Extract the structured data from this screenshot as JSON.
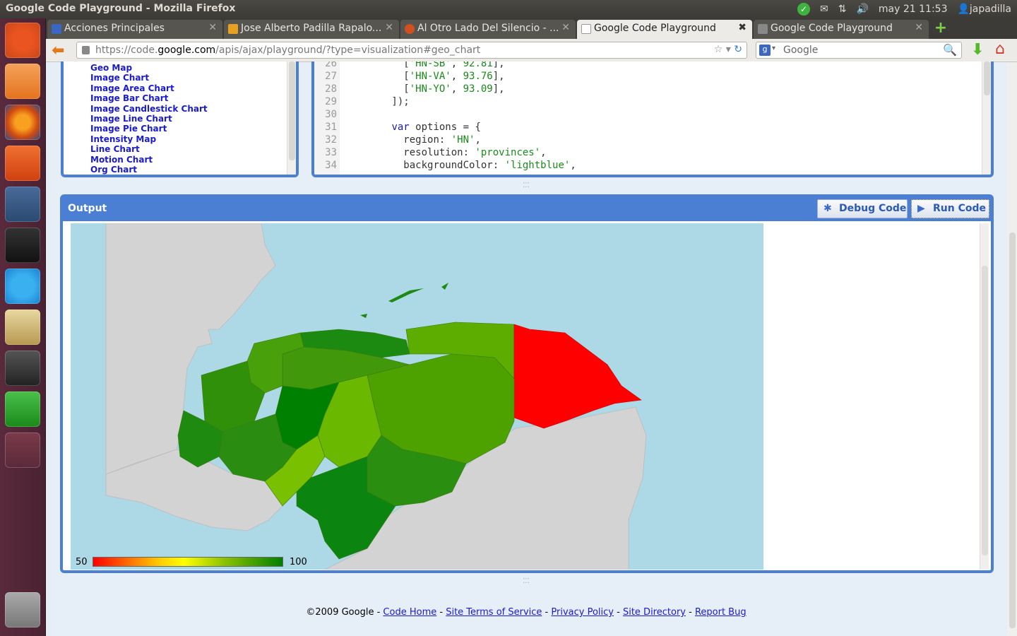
{
  "window": {
    "title": "Google Code Playground - Mozilla Firefox"
  },
  "tray": {
    "datetime": "may 21 11:53",
    "user": "japadilla"
  },
  "tabs": [
    {
      "label": "Acciones Principales",
      "favicon_color": "#3a66c4"
    },
    {
      "label": "Jose Alberto Padilla Rapalo...",
      "favicon_color": "#e8a020"
    },
    {
      "label": "Al Otro Lado Del Silencio - ...",
      "favicon_color": "#d05020"
    },
    {
      "label": "Google Code Playground",
      "favicon_color": "#cccccc"
    },
    {
      "label": "Google Code Playground",
      "favicon_color": "#aaaaaa"
    }
  ],
  "navbar": {
    "url_prefix": "https://code.",
    "url_domain": "google.com",
    "url_suffix": "/apis/ajax/playground/?type=visualization#geo_chart",
    "search_placeholder": "Google"
  },
  "sidebar": {
    "chart_items": [
      "Geo Map",
      "Image Chart",
      "Image Area Chart",
      "Image Bar Chart",
      "Image Candlestick Chart",
      "Image Line Chart",
      "Image Pie Chart",
      "Intensity Map",
      "Line Chart",
      "Motion Chart",
      "Org Chart"
    ]
  },
  "code": {
    "lines": [
      {
        "n": "26",
        "indent": "          ",
        "str1": "'HN-SB'",
        "num": "92.81",
        "tail": "],"
      },
      {
        "n": "27",
        "indent": "          ",
        "str1": "'HN-VA'",
        "num": "93.76",
        "tail": "],"
      },
      {
        "n": "28",
        "indent": "          ",
        "str1": "'HN-YO'",
        "num": "93.09",
        "tail": "],"
      },
      {
        "n": "29",
        "text": "        ]);"
      },
      {
        "n": "30",
        "text": ""
      },
      {
        "n": "31",
        "kw": "var",
        "text": " options = {"
      },
      {
        "n": "32",
        "key": "region",
        "val": "'HN'"
      },
      {
        "n": "33",
        "key": "resolution",
        "val": "'provinces'"
      },
      {
        "n": "34",
        "key": "backgroundColor",
        "val": "'lightblue'"
      }
    ]
  },
  "output": {
    "title": "Output",
    "debug_label": "Debug Code",
    "run_label": "Run Code",
    "legend_min": "50",
    "legend_max": "100",
    "colors": {
      "low": "#ff0000",
      "mid": "#ffff00",
      "high": "#008000",
      "background": "#add8e6",
      "land": "#d3d3d3"
    }
  },
  "footer": {
    "copyright": "©2009 Google",
    "sep": " - ",
    "links": [
      "Code Home",
      "Site Terms of Service",
      "Privacy Policy",
      "Site Directory",
      "Report Bug"
    ]
  }
}
